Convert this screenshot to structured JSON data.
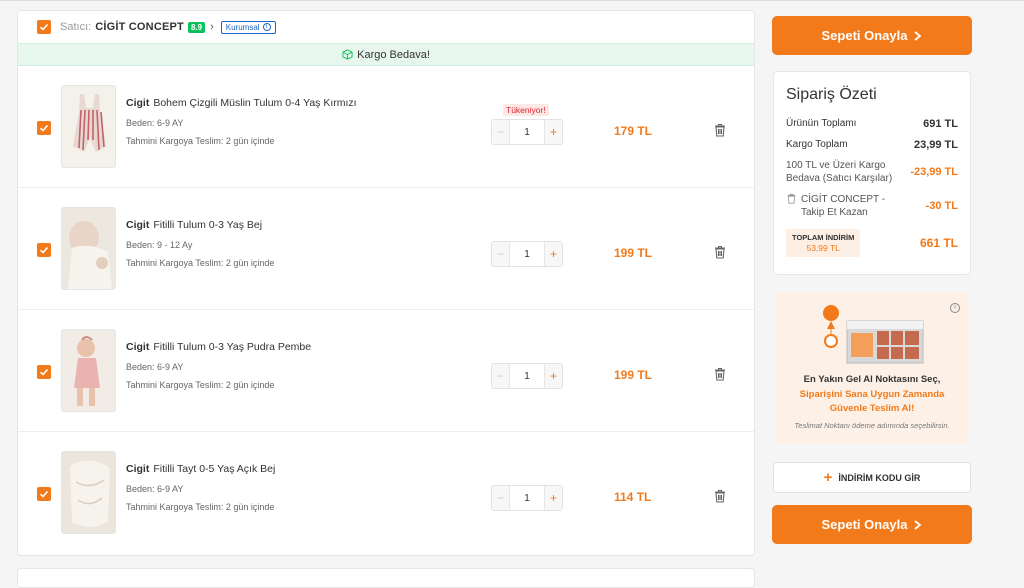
{
  "seller": {
    "label": "Satıcı:",
    "name": "CİGİT CONCEPT",
    "rating": "8.9",
    "chevron": "›",
    "corporate_label": "Kurumsal",
    "info_symbol": "i"
  },
  "shipping_banner": "Kargo Bedava!",
  "items": [
    {
      "brand": "Cigit",
      "name": "Bohem Çizgili Müslin Tulum 0-4 Yaş Kırmızı",
      "size": "Beden: 6-9 AY",
      "delivery": "Tahmini Kargoya Teslim:  2 gün içinde",
      "badge": "Tükeniyor!",
      "quantity": "1",
      "price": "179 TL"
    },
    {
      "brand": "Cigit",
      "name": "Fitilli Tulum 0-3 Yaş Bej",
      "size": "Beden: 9 - 12 Ay",
      "delivery": "Tahmini Kargoya Teslim:  2 gün içinde",
      "quantity": "1",
      "price": "199 TL"
    },
    {
      "brand": "Cigit",
      "name": "Fitilli Tulum 0-3 Yaş Pudra Pembe",
      "size": "Beden: 6-9 AY",
      "delivery": "Tahmini Kargoya Teslim:  2 gün içinde",
      "quantity": "1",
      "price": "199 TL"
    },
    {
      "brand": "Cigit",
      "name": "Fitilli Tayt 0-5 Yaş Açık Bej",
      "size": "Beden: 6-9 AY",
      "delivery": "Tahmini Kargoya Teslim:  2 gün içinde",
      "quantity": "1",
      "price": "114 TL"
    }
  ],
  "qty_minus": "−",
  "qty_plus": "+",
  "confirm_button": "Sepeti Onayla",
  "summary": {
    "title": "Sipariş Özeti",
    "products_total_label": "Ürünün Toplamı",
    "products_total": "691 TL",
    "shipping_total_label": "Kargo Toplam",
    "shipping_total": "23,99 TL",
    "free_shipping_label": "100 TL ve Üzeri Kargo Bedava (Satıcı Karşılar)",
    "free_shipping_value": "-23,99 TL",
    "seller_discount_label": "CİGİT CONCEPT - Takip Et Kazan",
    "seller_discount_value": "-30 TL",
    "total_discount_label": "TOPLAM İNDİRİM",
    "total_discount_value": "53,99 TL",
    "grand_total": "661 TL"
  },
  "promo": {
    "info_symbol": "i",
    "line1": "En Yakın Gel Al Noktasını Seç,",
    "line2": "Siparişini Sana Uygun Zamanda Güvenle Teslim Al!",
    "line3": "Teslimat Noktanı ödeme adımında seçebilirsin."
  },
  "coupon": {
    "plus": "+",
    "label": "İNDİRİM KODU GİR"
  },
  "colors": {
    "accent": "#f27a1a",
    "success": "#0bc15c",
    "corporate_blue": "#1e64c8"
  }
}
